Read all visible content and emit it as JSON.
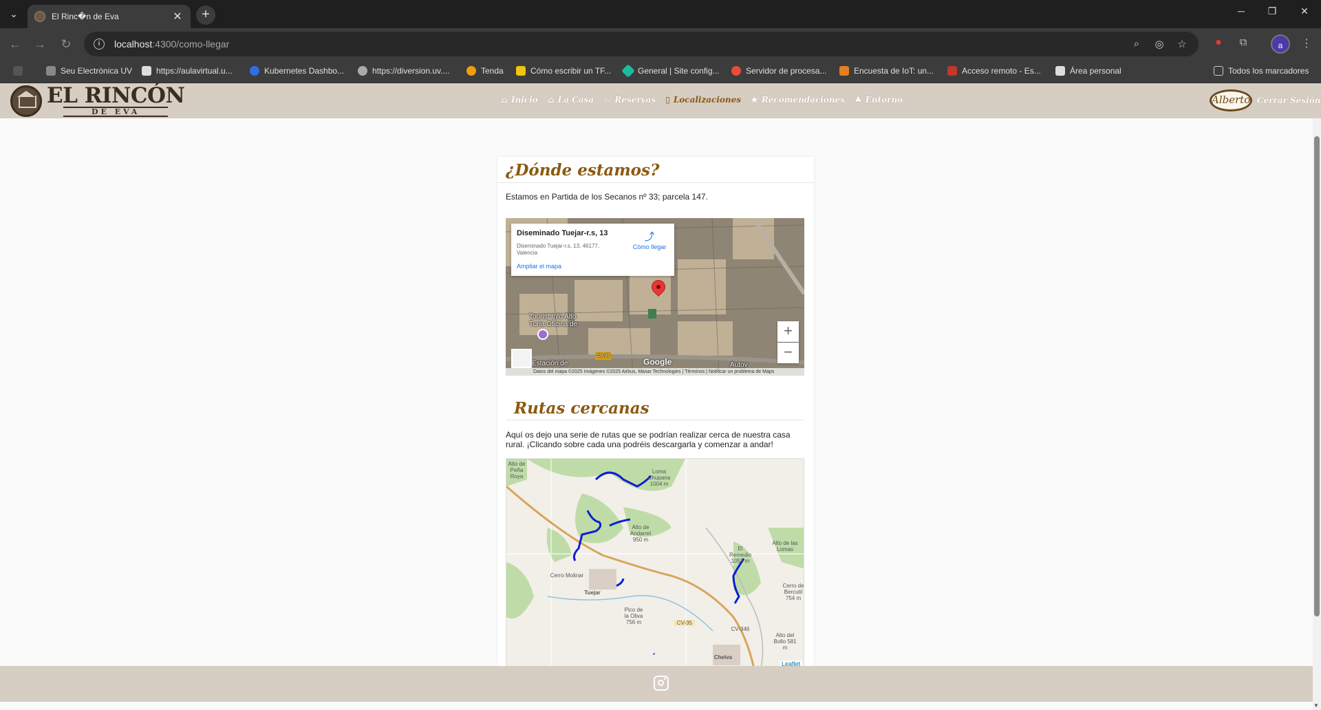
{
  "browser": {
    "tab_title": "El Rinc�n de Eva",
    "url_host": "localhost",
    "url_path": ":4300/como-llegar",
    "profile_initial": "a",
    "bookmarks": [
      "Seu Electrònica UV",
      "https://aulavirtual.u...",
      "Kubernetes Dashbo...",
      "https://diversion.uv....",
      "Tenda",
      "Cómo escribir un TF...",
      "General | Site config...",
      "Servidor de procesa...",
      "Encuesta de IoT: un...",
      "Acceso remoto - Es...",
      "Área personal"
    ],
    "all_bookmarks": "Todos los marcadores"
  },
  "site": {
    "logo_main": "EL RINCÓN",
    "logo_sub": "DE EVA",
    "menu": [
      "Inicio",
      "La Casa",
      "Reservas",
      "Localizaciones",
      "Recomendaciones",
      "Entorno"
    ],
    "active_menu": "Localizaciones",
    "user_name": "Alberto",
    "logout": "Cerrar Sesión"
  },
  "location": {
    "title": "¿Dónde estamos?",
    "text": "Estamos en Partida de los Secanos nº 33; parcela 147.",
    "map": {
      "place_name": "Diseminado Tuejar-r.s, 13",
      "address": "Diseminado Tuejar-r.s, 13, 46177, Valencia",
      "directions": "Cómo llegar",
      "enlarge": "Ampliar el mapa",
      "labels": [
        "Tourist Info Alto Turia Oficina de",
        "Estación de",
        "Autov",
        "CV-35"
      ],
      "attribution": "Datos del mapa ©2025 Imágenes ©2025 Airbus, Maxar Technologies | Términos | Notificar un problema de Maps",
      "google": "Google",
      "zoom_in": "+",
      "zoom_out": "−"
    }
  },
  "routes": {
    "title": "Rutas cercanas",
    "text": "Aquí os dejo una serie de rutas que se podrían realizar cerca de nuestra casa rural. ¡Clicando sobre cada una podréis descargarla y comenzar a andar!",
    "map_labels": [
      "Alto de Peña Roya",
      "Loma Chupana 1004 m",
      "Alto de Andarrel 950 m",
      "Cerro Molinar",
      "Tuejar",
      "Pico de la Oliva 756 m",
      "CV-35",
      "El Remedio 1053 m",
      "Alto de las Lomas",
      "Cerro de Bercutil 754 m",
      "CV-346",
      "Alto del Bollo 581 m",
      "Chelva"
    ],
    "attribution": "Leaflet"
  },
  "colors": {
    "accent": "#8a5a10",
    "nav_bg": "#d6cdc3",
    "route_line": "#0b1fd1"
  }
}
